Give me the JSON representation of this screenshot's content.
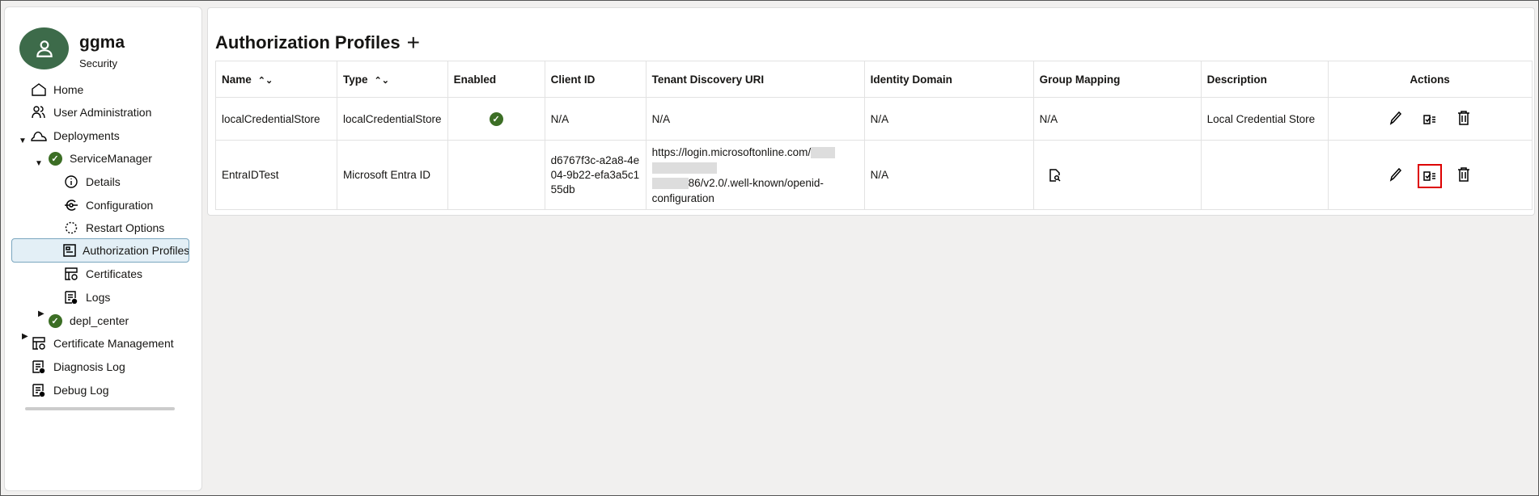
{
  "user": {
    "name": "ggma",
    "role": "Security"
  },
  "nav": {
    "home": "Home",
    "user_admin": "User Administration",
    "deployments": "Deployments",
    "service_manager": "ServiceManager",
    "details": "Details",
    "configuration": "Configuration",
    "restart": "Restart Options",
    "auth_profiles": "Authorization Profiles",
    "certificates": "Certificates",
    "logs": "Logs",
    "depl_center": "depl_center",
    "cert_mgmt": "Certificate Management",
    "diagnosis_log": "Diagnosis Log",
    "debug_log": "Debug Log"
  },
  "page": {
    "title": "Authorization Profiles",
    "add_icon": "+"
  },
  "table": {
    "headers": [
      "Name",
      "Type",
      "Enabled",
      "Client ID",
      "Tenant Discovery URI",
      "Identity Domain",
      "Group Mapping",
      "Description",
      "Actions"
    ],
    "rows": [
      {
        "name": "localCredentialStore",
        "type": "localCredentialStore",
        "enabled": true,
        "client_id": "N/A",
        "uri": "N/A",
        "identity_domain": "N/A",
        "group_mapping": "N/A",
        "description": "Local Credential Store"
      },
      {
        "name": "EntraIDTest",
        "type": "Microsoft Entra ID",
        "enabled": false,
        "client_id": "d6767f3c-a2a8-4e04-9b22-efa3a5c155db",
        "uri_a": "https://login.microsoftonline.com/",
        "uri_b": "86/v2.0/.well-known/openid-configuration",
        "identity_domain": "N/A",
        "group_mapping": "",
        "description": ""
      }
    ]
  },
  "colors": {
    "accent": "#3c6e25",
    "selected_bg": "#e3eff6",
    "highlight": "#dd0000"
  }
}
